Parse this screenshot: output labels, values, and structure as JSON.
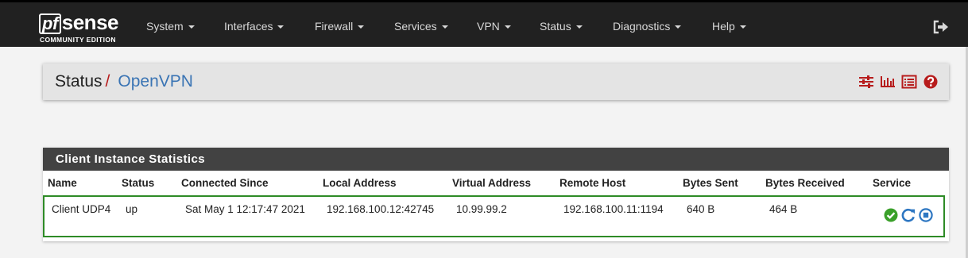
{
  "brand": {
    "logo_prefix": "pf",
    "logo_text": "sense",
    "edition": "COMMUNITY EDITION"
  },
  "nav": {
    "items": [
      {
        "label": "System"
      },
      {
        "label": "Interfaces"
      },
      {
        "label": "Firewall"
      },
      {
        "label": "Services"
      },
      {
        "label": "VPN"
      },
      {
        "label": "Status"
      },
      {
        "label": "Diagnostics"
      },
      {
        "label": "Help"
      }
    ],
    "logout_icon": "sign-out-icon"
  },
  "breadcrumb": {
    "parent": "Status",
    "separator": "/",
    "current": "OpenVPN",
    "icons": [
      "sliders-icon",
      "bar-chart-icon",
      "list-icon",
      "help-icon"
    ]
  },
  "panel": {
    "title": "Client Instance Statistics",
    "columns": [
      "Name",
      "Status",
      "Connected Since",
      "Local Address",
      "Virtual Address",
      "Remote Host",
      "Bytes Sent",
      "Bytes Received",
      "Service"
    ],
    "rows": [
      {
        "name": "Client UDP4",
        "status": "up",
        "connected_since": "Sat May 1 12:17:47 2021",
        "local_address": "192.168.100.12:42745",
        "virtual_address": "10.99.99.2",
        "remote_host": "192.168.100.11:1194",
        "bytes_sent": "640 B",
        "bytes_received": "464 B",
        "service_icons": [
          "running-check-icon",
          "restart-icon",
          "stop-icon"
        ]
      }
    ]
  },
  "colors": {
    "navbar": "#212121",
    "accent_red": "#b71c1c",
    "link_blue": "#3a74b4",
    "panel_header": "#424242",
    "row_border": "#2e8b26",
    "service_green": "#3aa02a",
    "service_blue": "#2e77c2"
  }
}
